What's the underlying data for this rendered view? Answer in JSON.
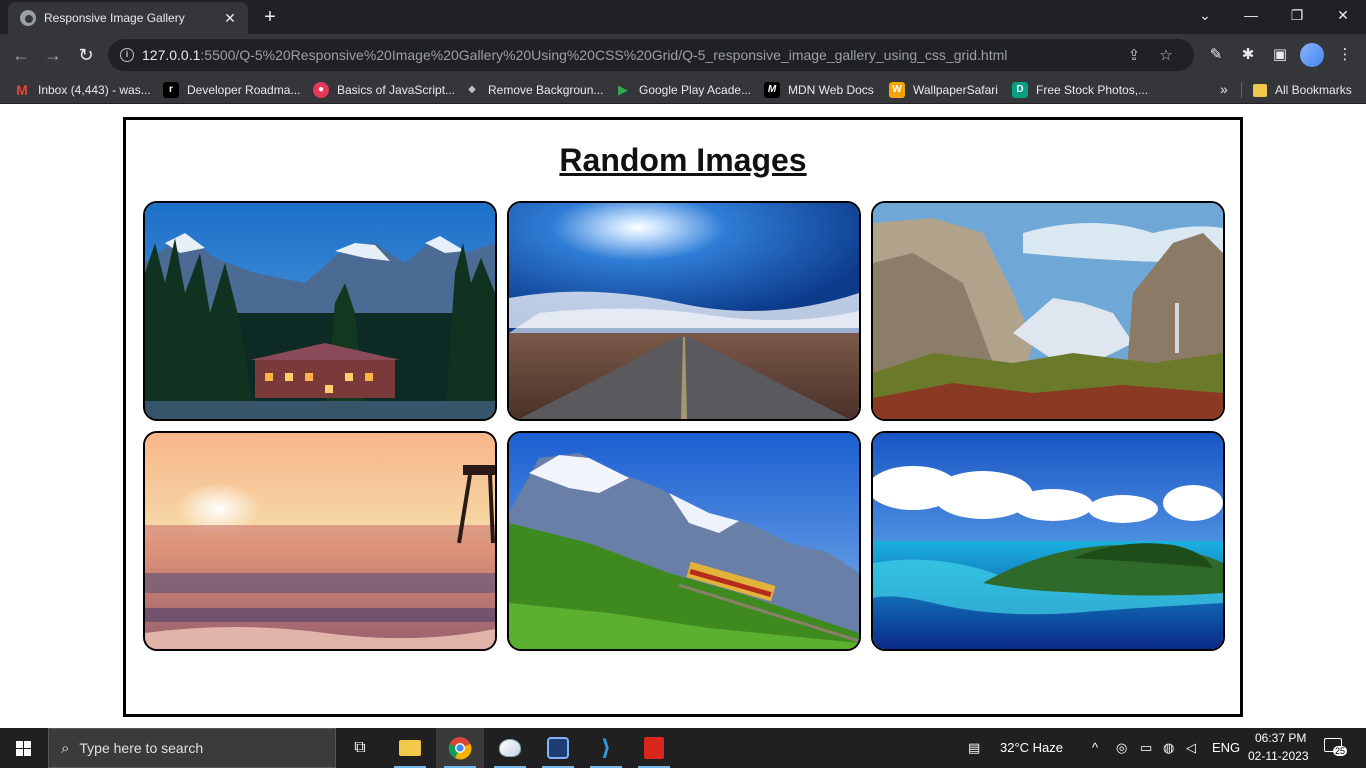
{
  "browser": {
    "tab_title": "Responsive Image Gallery",
    "tab_close": "✕",
    "new_tab": "+",
    "url_host": "127.0.0.1",
    "url_rest": ":5500/Q-5%20Responsive%20Image%20Gallery%20Using%20CSS%20Grid/Q-5_responsive_image_gallery_using_css_grid.html",
    "bookmarks": [
      {
        "label": "Inbox (4,443) - was...",
        "icon": "gmail-icon",
        "color": "#ea4335",
        "glyph": "M"
      },
      {
        "label": "Developer Roadma...",
        "icon": "roadmap-icon",
        "color": "#000000",
        "glyph": "r"
      },
      {
        "label": "Basics of JavaScript...",
        "icon": "js-course-icon",
        "color": "#e8365d",
        "glyph": "●"
      },
      {
        "label": "Remove Backgroun...",
        "icon": "removebg-icon",
        "color": "#6b6b6b",
        "glyph": "◆"
      },
      {
        "label": "Google Play Acade...",
        "icon": "google-play-icon",
        "color": "#34a853",
        "glyph": "▶"
      },
      {
        "label": "MDN Web Docs",
        "icon": "mdn-icon",
        "color": "#000000",
        "glyph": "M"
      },
      {
        "label": "WallpaperSafari",
        "icon": "wallpapersafari-icon",
        "color": "#f4a300",
        "glyph": "W"
      },
      {
        "label": "Free Stock Photos,...",
        "icon": "stock-photos-icon",
        "color": "#05a081",
        "glyph": "D"
      }
    ],
    "all_bookmarks": "All Bookmarks",
    "accent": "#8ab4f8"
  },
  "page": {
    "title": "Random Images",
    "images": [
      {
        "name": "mountain-lodge-image",
        "alt": "mountain lodge"
      },
      {
        "name": "desert-road-image",
        "alt": "desert road"
      },
      {
        "name": "yosemite-valley-image",
        "alt": "valley"
      },
      {
        "name": "sunset-beach-image",
        "alt": "sunset beach"
      },
      {
        "name": "alpine-train-image",
        "alt": "alpine train"
      },
      {
        "name": "tropical-island-image",
        "alt": "tropical island"
      }
    ]
  },
  "taskbar": {
    "search_placeholder": "Type here to search",
    "weather": "32°C  Haze",
    "language": "ENG",
    "time": "06:37 PM",
    "date": "02-11-2023",
    "notifications": "25"
  }
}
